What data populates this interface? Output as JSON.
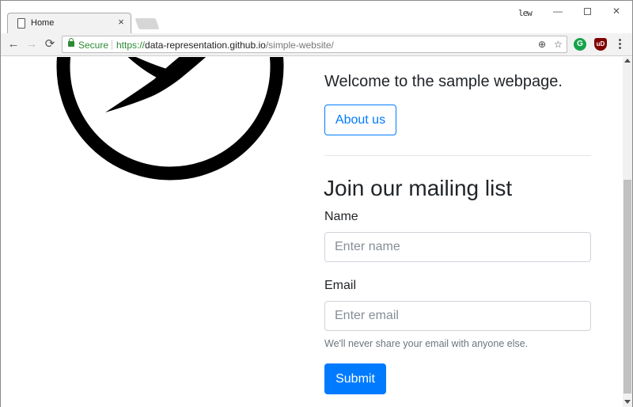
{
  "browser": {
    "tab_title": "Home",
    "tab_close": "×",
    "profile_badge": "lew",
    "window_min": "—",
    "window_close": "✕",
    "nav_back": "←",
    "nav_forward": "→",
    "nav_reload": "⟳",
    "secure_label": "Secure",
    "url_scheme": "https://",
    "url_host": "data-representation.github.io",
    "url_path": "/simple-website/",
    "zoom_icon": "⊕",
    "star_icon": "☆",
    "ext_grammarly": "G",
    "ext_ublock": "uD"
  },
  "page": {
    "welcome_text": "Welcome to the sample webpage.",
    "about_button": "About us",
    "mailing_heading": "Join our mailing list",
    "name_label": "Name",
    "name_placeholder": "Enter name",
    "email_label": "Email",
    "email_placeholder": "Enter email",
    "email_help": "We'll never share your email with anyone else.",
    "submit_button": "Submit"
  },
  "colors": {
    "primary": "#007bff",
    "secure_green": "#2c8a34",
    "text": "#212529",
    "muted": "#6c757d"
  }
}
